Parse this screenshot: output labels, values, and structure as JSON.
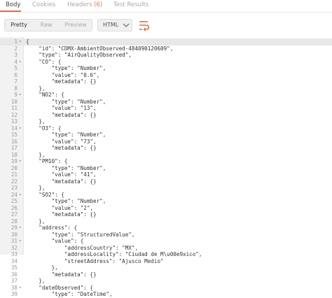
{
  "response_tabs": [
    {
      "label": "Body",
      "active": true
    },
    {
      "label": "Cookies",
      "active": false
    },
    {
      "label": "Headers",
      "count": "(6)",
      "active": false
    },
    {
      "label": "Test Results",
      "active": false
    }
  ],
  "view_modes": [
    "Pretty",
    "Raw",
    "Preview"
  ],
  "active_view_mode": "Pretty",
  "format_select": {
    "value": "HTML"
  },
  "wrap_icon": "wrap-lines-icon",
  "accent_color": "#f26b3a",
  "code_lines": [
    {
      "n": "1",
      "fold": "▾",
      "text": "{"
    },
    {
      "n": "2",
      "fold": "",
      "text": "    \"id\": \"CDMX-AmbientObserved-484090120609\","
    },
    {
      "n": "3",
      "fold": "",
      "text": "    \"type\": \"AirQualityObserved\","
    },
    {
      "n": "4",
      "fold": "▾",
      "text": "    \"CO\": {"
    },
    {
      "n": "5",
      "fold": "",
      "text": "        \"type\": \"Number\","
    },
    {
      "n": "6",
      "fold": "",
      "text": "        \"value\": \"0.6\","
    },
    {
      "n": "7",
      "fold": "",
      "text": "        \"metadata\": {}"
    },
    {
      "n": "8",
      "fold": "",
      "text": "    },"
    },
    {
      "n": "9",
      "fold": "▾",
      "text": "    \"NO2\": {"
    },
    {
      "n": "10",
      "fold": "",
      "text": "        \"type\": \"Number\","
    },
    {
      "n": "11",
      "fold": "",
      "text": "        \"value\": \"13\","
    },
    {
      "n": "12",
      "fold": "",
      "text": "        \"metadata\": {}"
    },
    {
      "n": "13",
      "fold": "",
      "text": "    },"
    },
    {
      "n": "14",
      "fold": "▾",
      "text": "    \"O3\": {"
    },
    {
      "n": "15",
      "fold": "",
      "text": "        \"type\": \"Number\","
    },
    {
      "n": "16",
      "fold": "",
      "text": "        \"value\": \"73\","
    },
    {
      "n": "17",
      "fold": "",
      "text": "        \"metadata\": {}"
    },
    {
      "n": "18",
      "fold": "",
      "text": "    },"
    },
    {
      "n": "19",
      "fold": "▾",
      "text": "    \"PM10\": {"
    },
    {
      "n": "20",
      "fold": "",
      "text": "        \"type\": \"Number\","
    },
    {
      "n": "21",
      "fold": "",
      "text": "        \"value\": \"41\","
    },
    {
      "n": "22",
      "fold": "",
      "text": "        \"metadata\": {}"
    },
    {
      "n": "23",
      "fold": "",
      "text": "    },"
    },
    {
      "n": "24",
      "fold": "▾",
      "text": "    \"SO2\": {"
    },
    {
      "n": "25",
      "fold": "",
      "text": "        \"type\": \"Number\","
    },
    {
      "n": "26",
      "fold": "",
      "text": "        \"value\": \"2\","
    },
    {
      "n": "27",
      "fold": "",
      "text": "        \"metadata\": {}"
    },
    {
      "n": "28",
      "fold": "",
      "text": "    },"
    },
    {
      "n": "29",
      "fold": "▾",
      "text": "    \"address\": {"
    },
    {
      "n": "30",
      "fold": "",
      "text": "        \"type\": \"StructuredValue\","
    },
    {
      "n": "31",
      "fold": "▾",
      "text": "        \"value\": {"
    },
    {
      "n": "32",
      "fold": "",
      "text": "            \"addressCountry\": \"MX\","
    },
    {
      "n": "33",
      "fold": "",
      "text": "            \"addressLocality\": \"Ciudad de M\\u00e9xico\","
    },
    {
      "n": "34",
      "fold": "",
      "text": "            \"streetAddress\": \"Ajusco Medio\""
    },
    {
      "n": "35",
      "fold": "",
      "text": "        },"
    },
    {
      "n": "36",
      "fold": "",
      "text": "        \"metadata\": {}"
    },
    {
      "n": "37",
      "fold": "",
      "text": "    },"
    },
    {
      "n": "38",
      "fold": "▾",
      "text": "    \"dateObserved\": {"
    },
    {
      "n": "39",
      "fold": "",
      "text": "        \"type\": \"DateTime\","
    }
  ]
}
